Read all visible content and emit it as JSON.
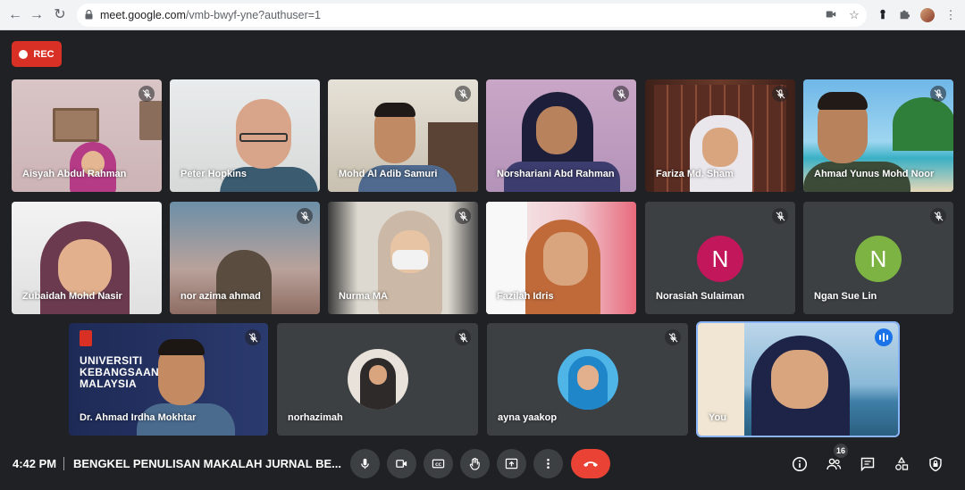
{
  "browser": {
    "url_domain": "meet.google.com",
    "url_path": "/vmb-bwyf-yne?authuser=1"
  },
  "rec": {
    "label": "REC"
  },
  "participants": [
    {
      "name": "Aisyah Abdul Rahman",
      "muted": true
    },
    {
      "name": "Peter Hopkins",
      "muted": false
    },
    {
      "name": "Mohd Al Adib Samuri",
      "muted": true
    },
    {
      "name": "Norshariani Abd Rahman",
      "muted": true
    },
    {
      "name": "Fariza Md. Sham",
      "muted": true
    },
    {
      "name": "Ahmad Yunus Mohd Noor",
      "muted": true
    },
    {
      "name": "Zubaidah Mohd Nasir",
      "muted": false
    },
    {
      "name": "nor azima ahmad",
      "muted": true
    },
    {
      "name": "Nurma MA",
      "muted": true
    },
    {
      "name": "Fazilah Idris",
      "muted": false
    },
    {
      "name": "Norasiah Sulaiman",
      "muted": true,
      "initial": "N",
      "color": "#c2185b"
    },
    {
      "name": "Ngan Sue Lin",
      "muted": true,
      "initial": "N",
      "color": "#7cb342"
    },
    {
      "name": "Dr. Ahmad Irdha Mokhtar",
      "muted": true,
      "background_text": [
        "UNIVERSITI",
        "KEBANGSAAN",
        "MALAYSIA"
      ]
    },
    {
      "name": "norhazimah",
      "muted": true
    },
    {
      "name": "ayna yaakop",
      "muted": true
    },
    {
      "name": "You",
      "muted": false,
      "speaking": true
    }
  ],
  "bottom_bar": {
    "time": "4:42 PM",
    "meeting_title": "BENGKEL PENULISAN MAKALAH JURNAL BE...",
    "participant_count": "16"
  },
  "colors": {
    "background": "#202124",
    "tile": "#3c4043",
    "rec": "#d93025",
    "hangup": "#ea4335",
    "speaking": "#1a73e8"
  },
  "icons": [
    "back-icon",
    "forward-icon",
    "reload-icon",
    "lock-icon",
    "camera-blocked-icon",
    "star-icon",
    "extension-icon",
    "puzzle-icon",
    "menu-icon",
    "mic-icon",
    "camera-icon",
    "captions-icon",
    "raise-hand-icon",
    "present-icon",
    "more-options-icon",
    "hangup-icon",
    "info-icon",
    "people-icon",
    "chat-icon",
    "activities-icon",
    "host-controls-icon"
  ]
}
